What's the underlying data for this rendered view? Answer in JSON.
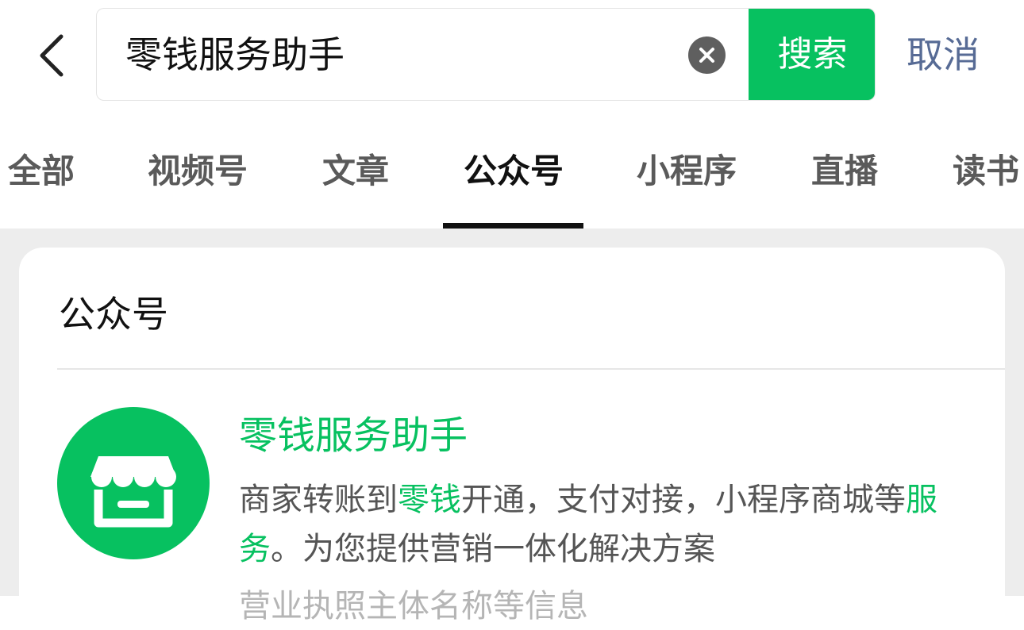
{
  "search": {
    "value": "零钱服务助手",
    "button_label": "搜索",
    "cancel_label": "取消"
  },
  "tabs": [
    {
      "label": "全部"
    },
    {
      "label": "视频号"
    },
    {
      "label": "文章"
    },
    {
      "label": "公众号",
      "active": true
    },
    {
      "label": "小程序"
    },
    {
      "label": "直播"
    },
    {
      "label": "读书"
    }
  ],
  "section": {
    "title": "公众号"
  },
  "result": {
    "name": "零钱服务助手",
    "desc_part1": "商家转账到",
    "desc_hl1": "零钱",
    "desc_part2": "开通，支付对接，小程序商城等",
    "desc_hl2": "服务",
    "desc_part3": "。为您提供营销一体化解决方案",
    "extra": "营业执照主体名称等信息"
  },
  "icons": {
    "back": "chevron-left-icon",
    "clear": "clear-icon",
    "avatar": "storefront-icon"
  },
  "colors": {
    "accent": "#07c160",
    "link": "#576b95"
  }
}
